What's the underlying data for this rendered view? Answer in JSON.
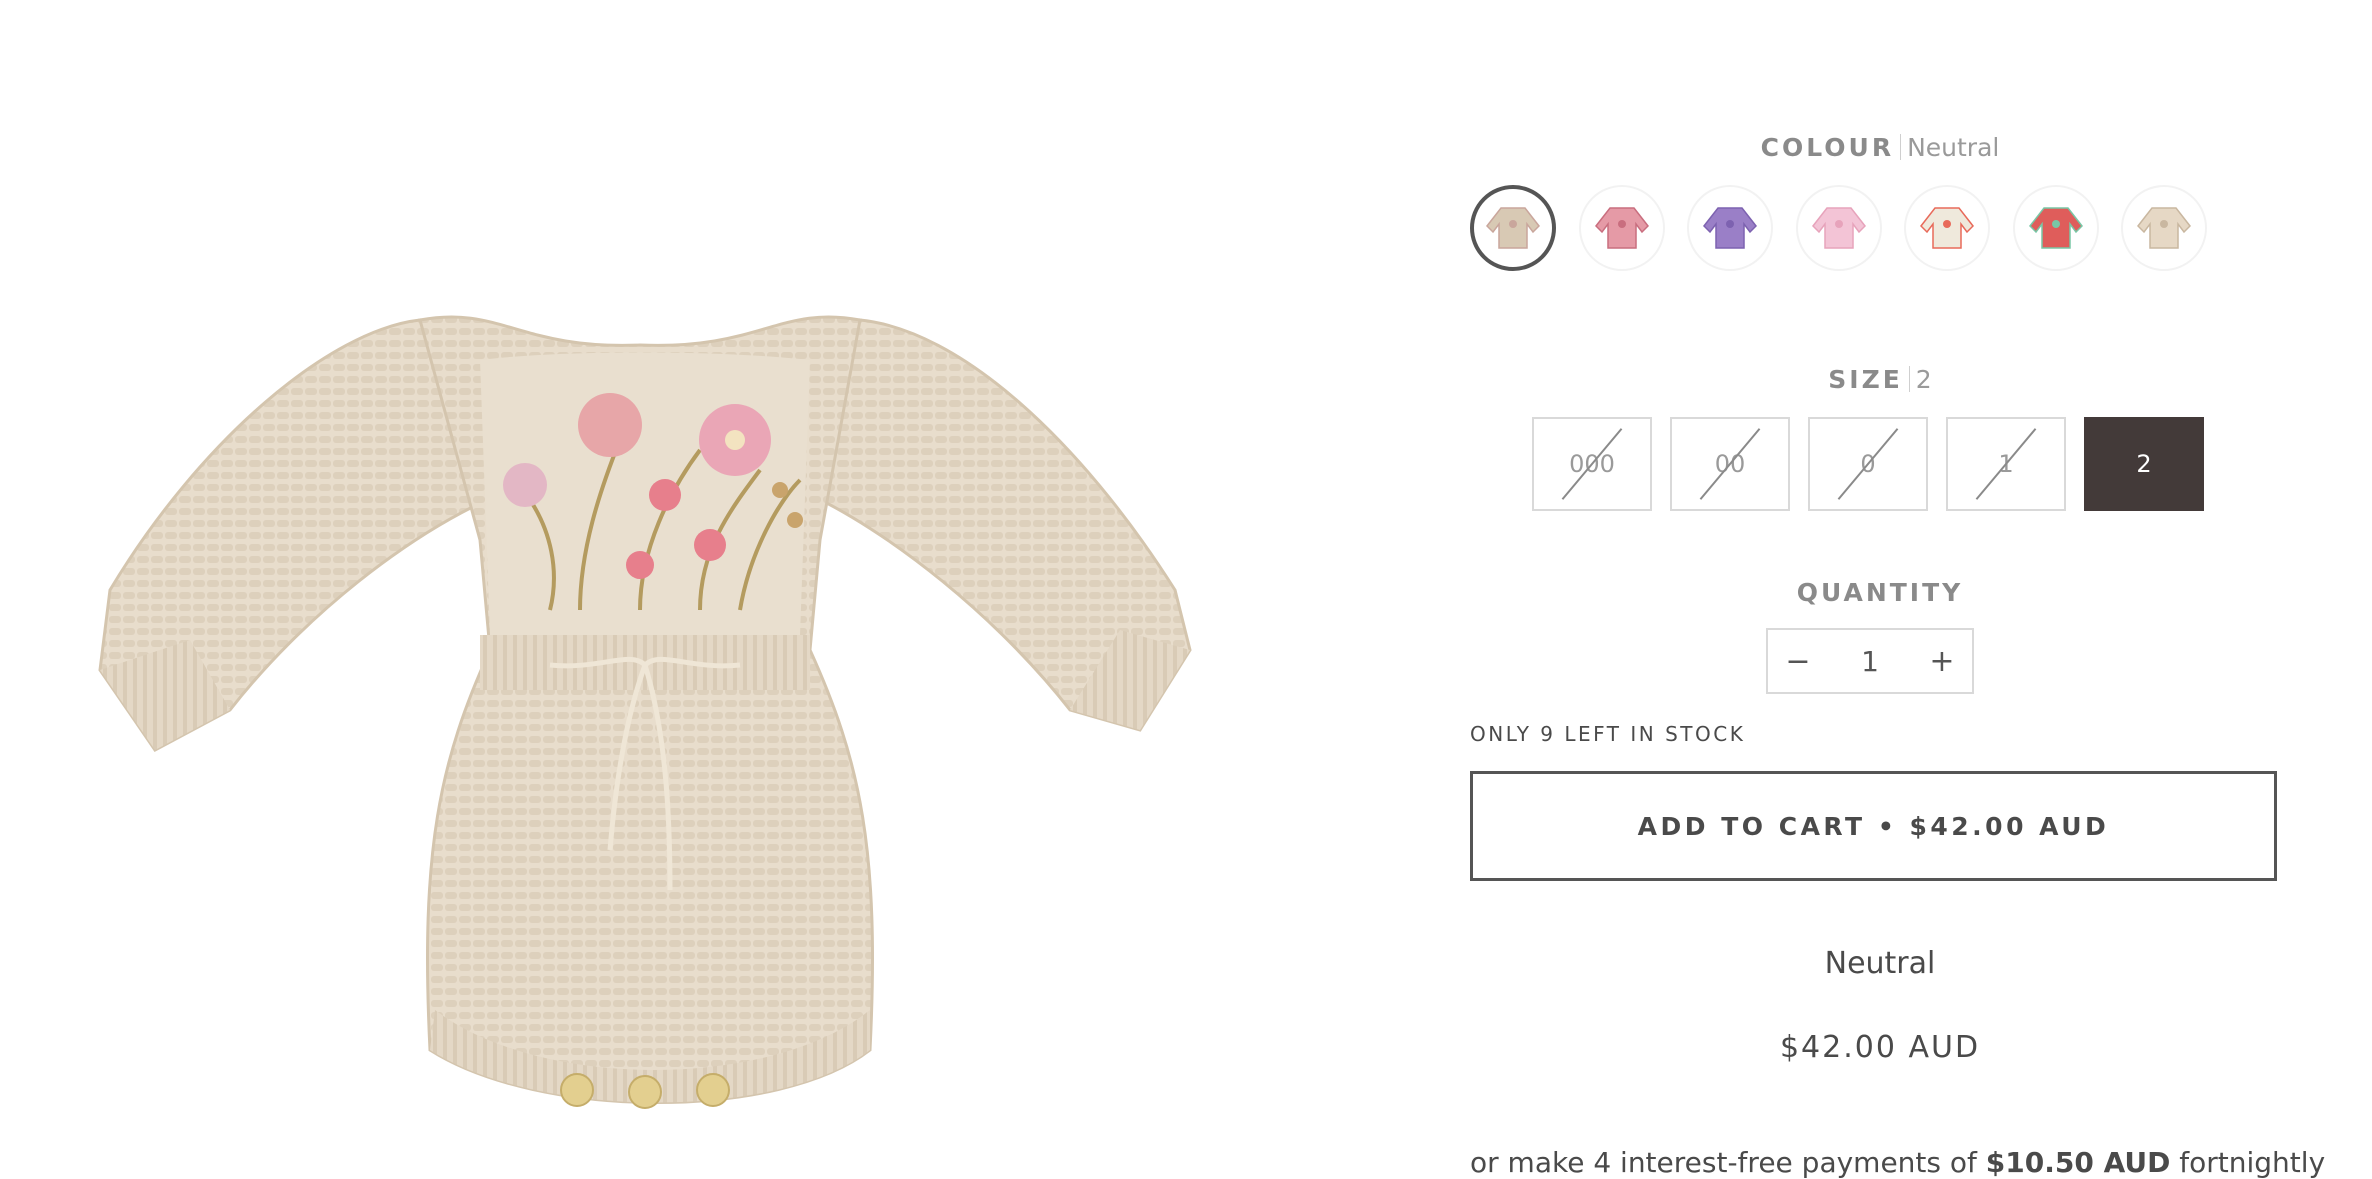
{
  "product": {
    "image_alt": "Neutral knitted romper with embroidered flowers",
    "variant_title": "Neutral",
    "price": "$42.00 AUD"
  },
  "colour": {
    "label": "COLOUR",
    "selected": "Neutral",
    "swatches": [
      {
        "name": "neutral-romper",
        "color": "#d8c9b4",
        "accent": "#c9a69c",
        "selected": true
      },
      {
        "name": "pink-romper",
        "color": "#e59aa6",
        "accent": "#c96e7f",
        "selected": false
      },
      {
        "name": "purple-romper",
        "color": "#9a7fc7",
        "accent": "#7d62b0",
        "selected": false
      },
      {
        "name": "light-pink-romper",
        "color": "#f3c4d6",
        "accent": "#e7a3bb",
        "selected": false
      },
      {
        "name": "tie-romper-cream",
        "color": "#efe9dc",
        "accent": "#e86a5a",
        "selected": false
      },
      {
        "name": "tie-romper-red",
        "color": "#df5d5b",
        "accent": "#78c7a6",
        "selected": false
      },
      {
        "name": "neutral-long-romper",
        "color": "#e6d8c5",
        "accent": "#c9b7a0",
        "selected": false
      }
    ]
  },
  "size": {
    "label": "SIZE",
    "selected": "2",
    "options": [
      {
        "label": "000",
        "available": false
      },
      {
        "label": "00",
        "available": false
      },
      {
        "label": "0",
        "available": false
      },
      {
        "label": "1",
        "available": false
      },
      {
        "label": "2",
        "available": true,
        "selected": true
      }
    ]
  },
  "quantity": {
    "label": "QUANTITY",
    "minus": "−",
    "value": "1",
    "plus": "+"
  },
  "stock_message": "ONLY 9 LEFT IN STOCK",
  "cart_button": "ADD TO CART • $42.00 AUD",
  "afterpay": {
    "prefix": "or make 4 interest-free payments of",
    "amount": "$10.50 AUD",
    "suffix": "fortnightly"
  }
}
